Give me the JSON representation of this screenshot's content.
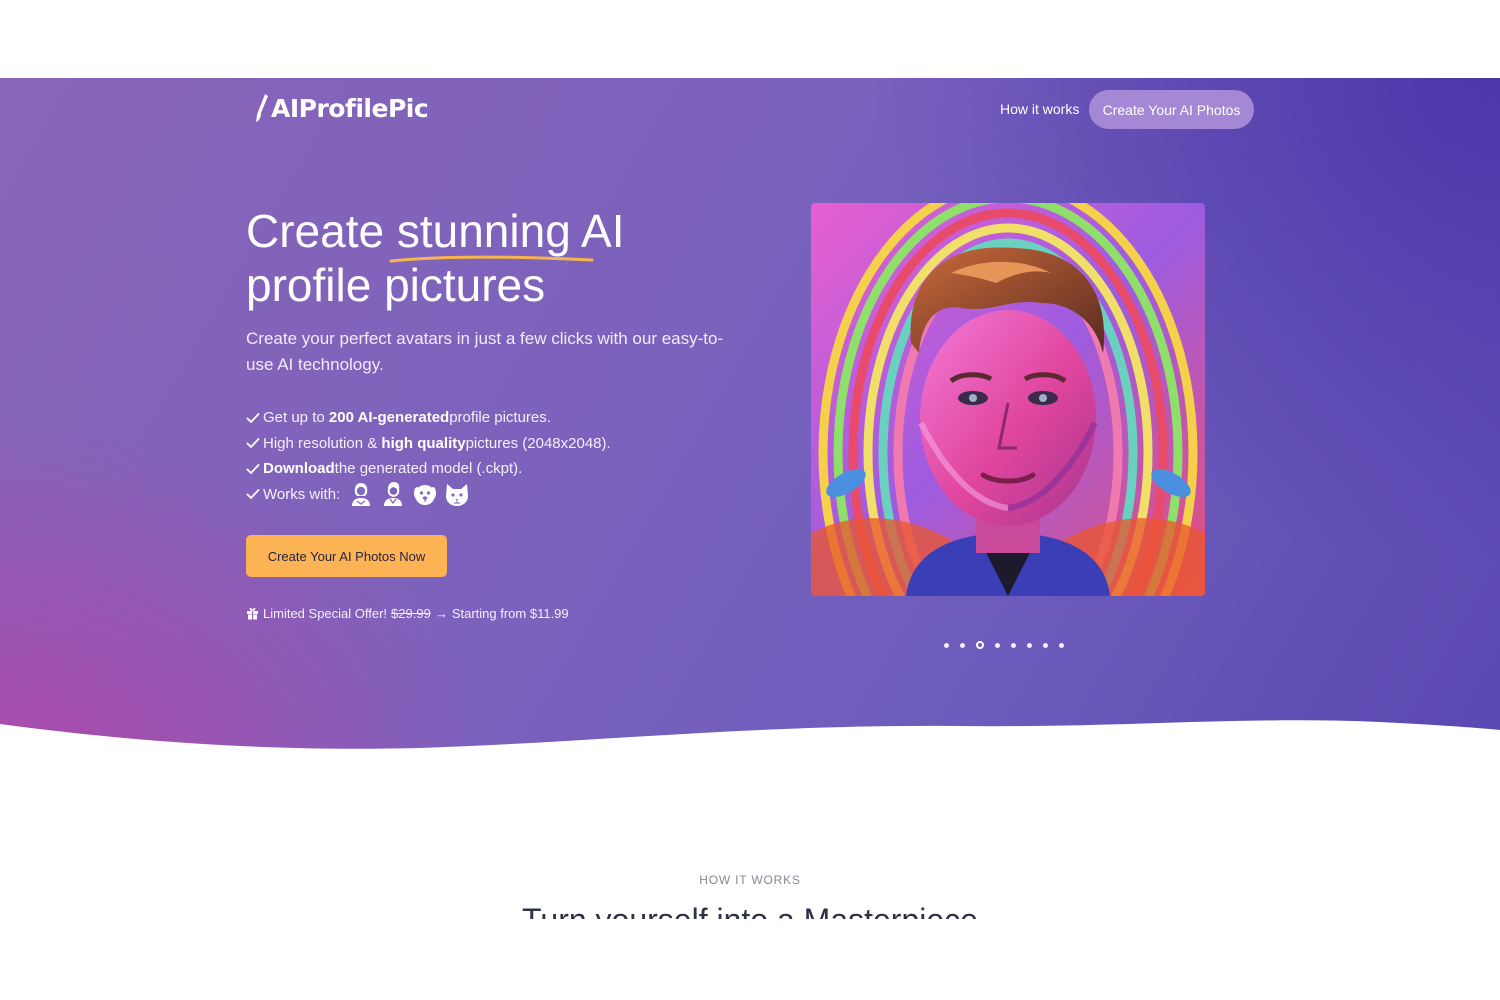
{
  "brand": {
    "name": "AIProfilePic"
  },
  "nav": {
    "how_it_works": "How it works",
    "cta": "Create Your AI Photos"
  },
  "hero": {
    "headline_part1": "Create ",
    "headline_highlight": "stunning",
    "headline_part2": " AI",
    "headline_line2": "profile pictures",
    "subhead": "Create your perfect avatars in just a few clicks with our easy-to-use AI technology.",
    "features": [
      {
        "pre": "Get up to ",
        "bold": "200 AI-generated",
        "post": " profile pictures."
      },
      {
        "pre": "High resolution & ",
        "bold": "high quality",
        "post": " pictures (2048x2048)."
      },
      {
        "pre": "",
        "bold": "Download",
        "post": " the generated model (.ckpt)."
      },
      {
        "pre": "Works with:",
        "bold": "",
        "post": ""
      }
    ],
    "works_with_icons": [
      "woman-icon",
      "man-icon",
      "dog-icon",
      "cat-icon"
    ],
    "cta": "Create Your AI Photos Now",
    "offer": {
      "label": "Limited Special Offer!",
      "old_price": "$29.99",
      "arrow": "→",
      "new_price_text": "Starting from $11.99"
    },
    "carousel": {
      "slides": 8,
      "active_index": 2
    }
  },
  "section": {
    "label": "HOW IT WORKS",
    "title": "Turn yourself into a Masterpiece"
  },
  "colors": {
    "cta_bg": "#fbb354",
    "nav_cta_bg": "#a488d6",
    "underline": "#f5b54e",
    "hero_purple": "#7a62bd"
  }
}
